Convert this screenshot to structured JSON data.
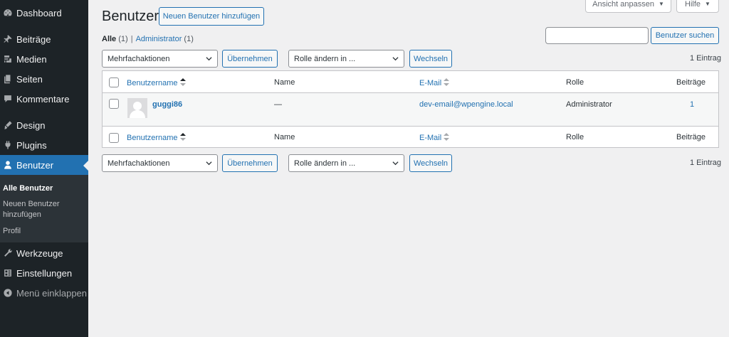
{
  "sidebar": {
    "items": [
      {
        "id": "dashboard",
        "label": "Dashboard",
        "icon": "dashboard-icon"
      },
      {
        "id": "posts",
        "label": "Beiträge",
        "icon": "pin-icon"
      },
      {
        "id": "media",
        "label": "Medien",
        "icon": "media-icon"
      },
      {
        "id": "pages",
        "label": "Seiten",
        "icon": "pages-icon"
      },
      {
        "id": "comments",
        "label": "Kommentare",
        "icon": "comment-icon"
      },
      {
        "id": "appearance",
        "label": "Design",
        "icon": "brush-icon"
      },
      {
        "id": "plugins",
        "label": "Plugins",
        "icon": "plugin-icon"
      },
      {
        "id": "users",
        "label": "Benutzer",
        "icon": "user-icon"
      },
      {
        "id": "tools",
        "label": "Werkzeuge",
        "icon": "wrench-icon"
      },
      {
        "id": "settings",
        "label": "Einstellungen",
        "icon": "settings-icon"
      },
      {
        "id": "collapse",
        "label": "Menü einklappen",
        "icon": "collapse-icon"
      }
    ],
    "submenu": [
      {
        "label": "Alle Benutzer",
        "current": true
      },
      {
        "label": "Neuen Benutzer hinzufügen",
        "current": false
      },
      {
        "label": "Profil",
        "current": false
      }
    ],
    "accent": "#2271b1"
  },
  "screen_meta": {
    "screen_options": "Ansicht anpassen",
    "help": "Hilfe"
  },
  "header": {
    "title": "Benutzer",
    "add_new": "Neuen Benutzer hinzufügen"
  },
  "filters": {
    "all_label": "Alle",
    "all_count": "(1)",
    "separator": "|",
    "admin_label": "Administrator",
    "admin_count": "(1)"
  },
  "search": {
    "value": "",
    "button": "Benutzer suchen"
  },
  "tablenav": {
    "bulk_actions": "Mehrfachaktionen",
    "apply": "Übernehmen",
    "change_role": "Rolle ändern in ...",
    "change": "Wechseln",
    "items_count": "1 Eintrag"
  },
  "table": {
    "columns": {
      "username": "Benutzername",
      "name": "Name",
      "email": "E-Mail",
      "role": "Rolle",
      "posts": "Beiträge"
    },
    "rows": [
      {
        "username": "guggi86",
        "name": "—",
        "email": "dev-email@wpengine.local",
        "role": "Administrator",
        "posts": "1"
      }
    ]
  }
}
